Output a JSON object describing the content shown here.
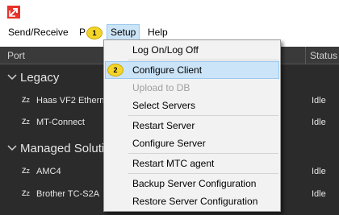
{
  "menubar": {
    "items": [
      {
        "label": "Send/Receive"
      },
      {
        "label": "P"
      },
      {
        "label": "Setup"
      },
      {
        "label": "Help"
      }
    ]
  },
  "grid": {
    "columns": {
      "port": "Port",
      "status": "Status"
    },
    "groups": [
      {
        "label": "Legacy",
        "rows": [
          {
            "name": "Haas VF2 Etherne",
            "status": "Idle"
          },
          {
            "name": "MT-Connect",
            "status": "Idle"
          }
        ]
      },
      {
        "label": "Managed Soluti",
        "rows": [
          {
            "name": "AMC4",
            "status": "Idle"
          },
          {
            "name": "Brother TC-S2A",
            "status": "Idle"
          }
        ]
      }
    ]
  },
  "setup_menu": {
    "items": [
      {
        "label": "Log On/Log Off"
      },
      {
        "label": "Configure Client"
      },
      {
        "label": "Upload to DB"
      },
      {
        "label": "Select Servers"
      },
      {
        "label": "Restart Server"
      },
      {
        "label": "Configure Server"
      },
      {
        "label": "Restart MTC agent"
      },
      {
        "label": "Backup Server Configuration"
      },
      {
        "label": "Restore Server Configuration"
      }
    ]
  },
  "callouts": {
    "step1": "1",
    "step2": "2"
  },
  "zz_glyph": {
    "big": "Z",
    "small": "Z"
  },
  "colors": {
    "accent_highlight": "#cce4f7",
    "callout": "#f5d52a",
    "app_icon": "#e8322a",
    "grid_bg": "#2b2b2b"
  }
}
